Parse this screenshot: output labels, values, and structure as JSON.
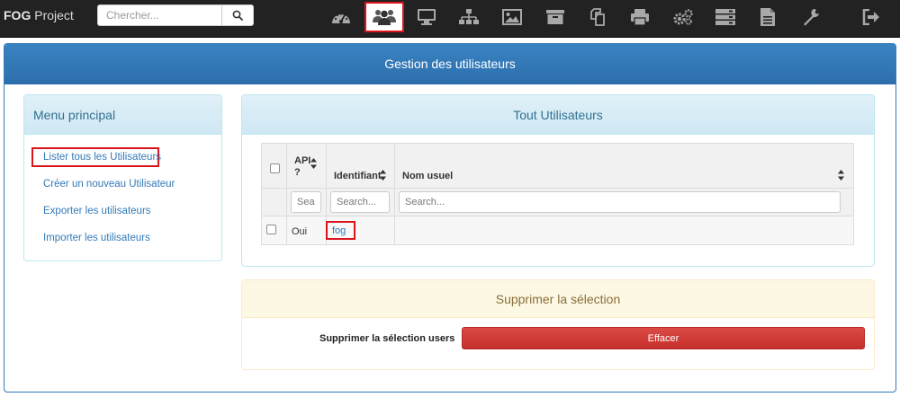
{
  "navbar": {
    "brand_bold": "FOG",
    "brand_rest": " Project",
    "search_placeholder": "Chercher...",
    "search_icon": "search-icon",
    "icons": [
      {
        "name": "dashboard-icon"
      },
      {
        "name": "users-icon",
        "active": true
      },
      {
        "name": "hosts-icon"
      },
      {
        "name": "groups-icon"
      },
      {
        "name": "images-icon"
      },
      {
        "name": "storage-icon"
      },
      {
        "name": "snapins-icon"
      },
      {
        "name": "printers-icon"
      },
      {
        "name": "services-icon"
      },
      {
        "name": "tasks-icon"
      },
      {
        "name": "reports-icon"
      },
      {
        "name": "settings-icon"
      },
      {
        "name": "logout-icon"
      }
    ],
    "active_color": "#d9141b"
  },
  "page": {
    "title": "Gestion des utilisateurs"
  },
  "menu": {
    "title": "Menu principal",
    "items": [
      {
        "label": "Lister tous les Utilisateurs",
        "highlighted": true
      },
      {
        "label": "Créer un nouveau Utilisateur"
      },
      {
        "label": "Exporter les utilisateurs"
      },
      {
        "label": "Importer les utilisateurs"
      }
    ]
  },
  "users": {
    "title": "Tout Utilisateurs",
    "columns": {
      "api_line1": "API",
      "api_line2": "?",
      "identifier": "Identifiant",
      "name": "Nom usuel"
    },
    "filter_placeholders": {
      "api": "Search...",
      "identifier": "Search...",
      "name": "Search..."
    },
    "rows": [
      {
        "api": "Oui",
        "identifier": "fog",
        "name": ""
      }
    ]
  },
  "delete": {
    "title": "Supprimer la sélection",
    "label": "Supprimer la sélection users",
    "button": "Effacer"
  }
}
